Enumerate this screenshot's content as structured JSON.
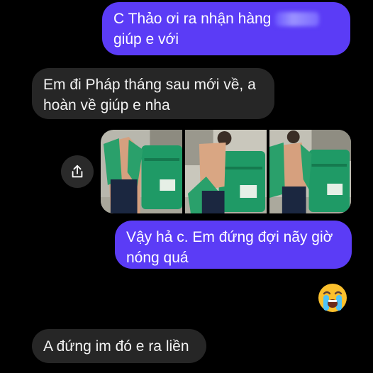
{
  "messages": [
    {
      "id": "m1",
      "sender": "me",
      "line1": "C Thảo ơi ra nhận hàng",
      "line2": "giúp e với"
    },
    {
      "id": "m2",
      "sender": "other",
      "line1": "Em đi Pháp tháng sau mới về, a",
      "line2": "hoàn về giúp e nha"
    },
    {
      "id": "m3",
      "sender": "me",
      "line1": "Vậy hả c. Em đứng đợi nãy giờ",
      "line2": "nóng quá"
    },
    {
      "id": "m5",
      "sender": "other",
      "line1": "A đứng im đó e ra liền"
    }
  ],
  "reaction": {
    "icon": "loudly-crying-face-icon"
  },
  "share": {
    "icon": "share-icon"
  },
  "colors": {
    "sent": "#5b3cf6",
    "received": "#262626",
    "background": "#000000",
    "bag": "#1f9a66"
  }
}
